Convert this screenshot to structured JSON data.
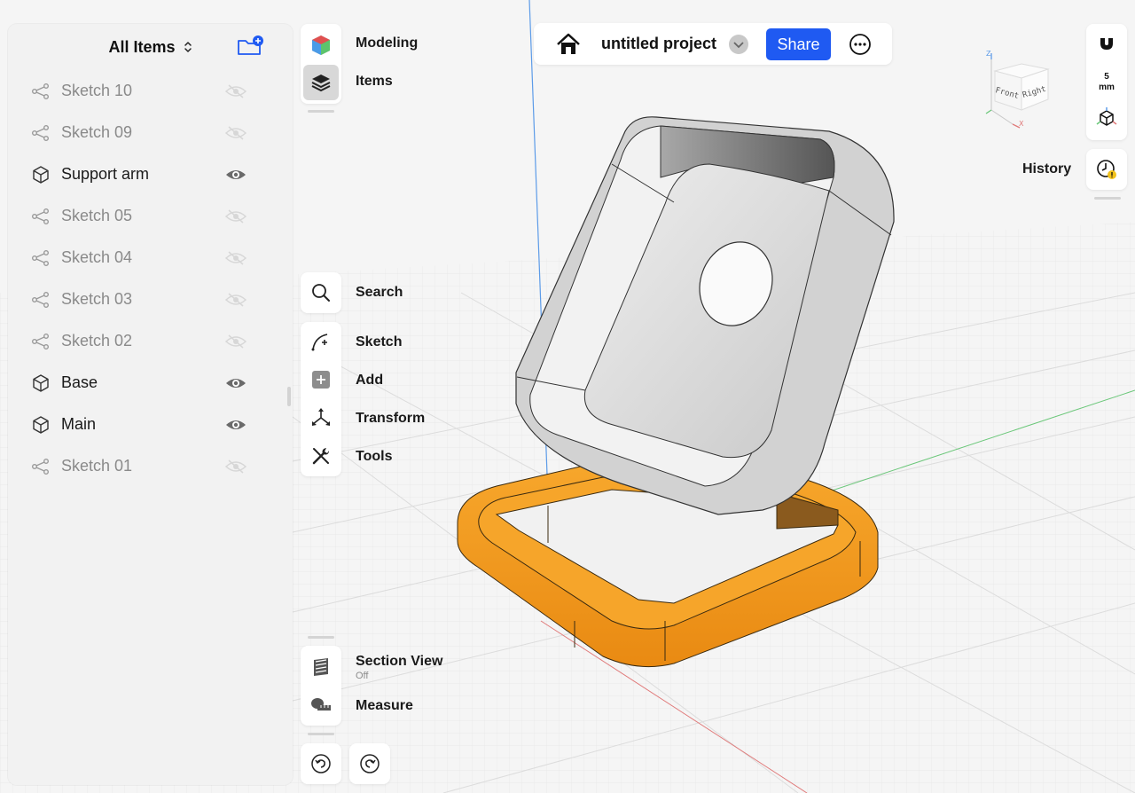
{
  "items_panel": {
    "title": "All Items",
    "items": [
      {
        "label": "Sketch 10",
        "kind": "sketch",
        "visible": false
      },
      {
        "label": "Sketch 09",
        "kind": "sketch",
        "visible": false
      },
      {
        "label": "Support arm",
        "kind": "body",
        "visible": true
      },
      {
        "label": "Sketch 05",
        "kind": "sketch",
        "visible": false
      },
      {
        "label": "Sketch 04",
        "kind": "sketch",
        "visible": false
      },
      {
        "label": "Sketch 03",
        "kind": "sketch",
        "visible": false
      },
      {
        "label": "Sketch 02",
        "kind": "sketch",
        "visible": false
      },
      {
        "label": "Base",
        "kind": "body",
        "visible": true
      },
      {
        "label": "Main",
        "kind": "body",
        "visible": true
      },
      {
        "label": "Sketch 01",
        "kind": "sketch",
        "visible": false
      }
    ]
  },
  "toolbar": {
    "modeling_label": "Modeling",
    "items_label": "Items",
    "search_label": "Search",
    "sketch_label": "Sketch",
    "add_label": "Add",
    "transform_label": "Transform",
    "tools_label": "Tools",
    "section_view_label": "Section View",
    "section_view_state": "Off",
    "measure_label": "Measure"
  },
  "project": {
    "name": "untitled project",
    "share_label": "Share"
  },
  "snap": {
    "value": "5",
    "unit": "mm"
  },
  "view_cube": {
    "front_label": "Front",
    "right_label": "Right",
    "z_label": "Z",
    "x_label": "X"
  },
  "history_label": "History",
  "colors": {
    "accent": "#1f5af2",
    "base_model": "#f39a1f",
    "support_model": "#d9d9d9",
    "background": "#f4f4f4"
  }
}
